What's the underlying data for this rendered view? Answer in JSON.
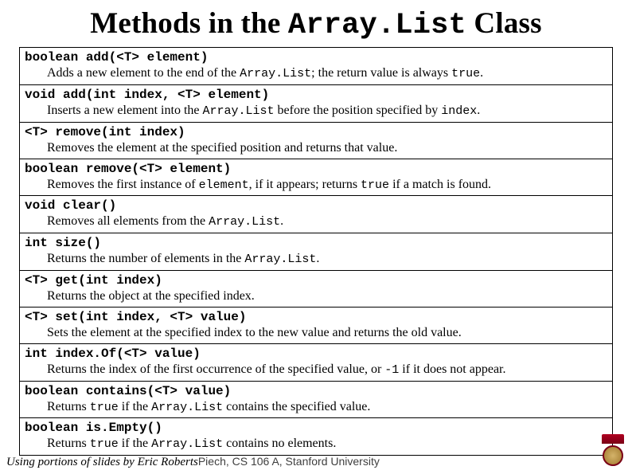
{
  "title": {
    "prefix": "Methods in the ",
    "code": "Array.List",
    "suffix": " Class"
  },
  "methods": [
    {
      "signature": "boolean add(<T> element)",
      "desc_parts": [
        "Adds a new element to the end of the ",
        "Array.List",
        "; the return value is always ",
        "true",
        "."
      ]
    },
    {
      "signature": "void add(int index, <T> element)",
      "desc_parts": [
        "Inserts a new element into the ",
        "Array.List",
        " before the position specified by ",
        "index",
        "."
      ]
    },
    {
      "signature": "<T> remove(int index)",
      "desc_parts": [
        "Removes the element at the specified position and returns that value."
      ]
    },
    {
      "signature": "boolean remove(<T> element)",
      "desc_parts": [
        "Removes the first instance of ",
        "element",
        ", if it appears; returns ",
        "true",
        " if a match is found."
      ]
    },
    {
      "signature": "void clear()",
      "desc_parts": [
        "Removes all elements from the ",
        "Array.List",
        "."
      ]
    },
    {
      "signature": "int size()",
      "desc_parts": [
        "Returns the number of elements in the ",
        "Array.List",
        "."
      ]
    },
    {
      "signature": "<T> get(int index)",
      "desc_parts": [
        "Returns the object at the specified index."
      ]
    },
    {
      "signature": "<T> set(int index, <T> value)",
      "desc_parts": [
        "Sets the element at the specified index to the new value and returns the old value."
      ]
    },
    {
      "signature": "int index.Of(<T> value)",
      "desc_parts": [
        "Returns the index of the first occurrence of the specified value, or ",
        "-1",
        " if it does not appear."
      ]
    },
    {
      "signature": "boolean contains(<T> value)",
      "desc_parts": [
        "Returns ",
        "true",
        " if the ",
        "Array.List",
        " contains the specified value."
      ]
    },
    {
      "signature": "boolean is.Empty()",
      "desc_parts": [
        "Returns ",
        "true",
        " if the ",
        "Array.List",
        " contains no elements."
      ]
    }
  ],
  "footer": {
    "attribution": "Using portions of slides by Eric Roberts",
    "course": "Piech, CS 106 A, Stanford University"
  }
}
